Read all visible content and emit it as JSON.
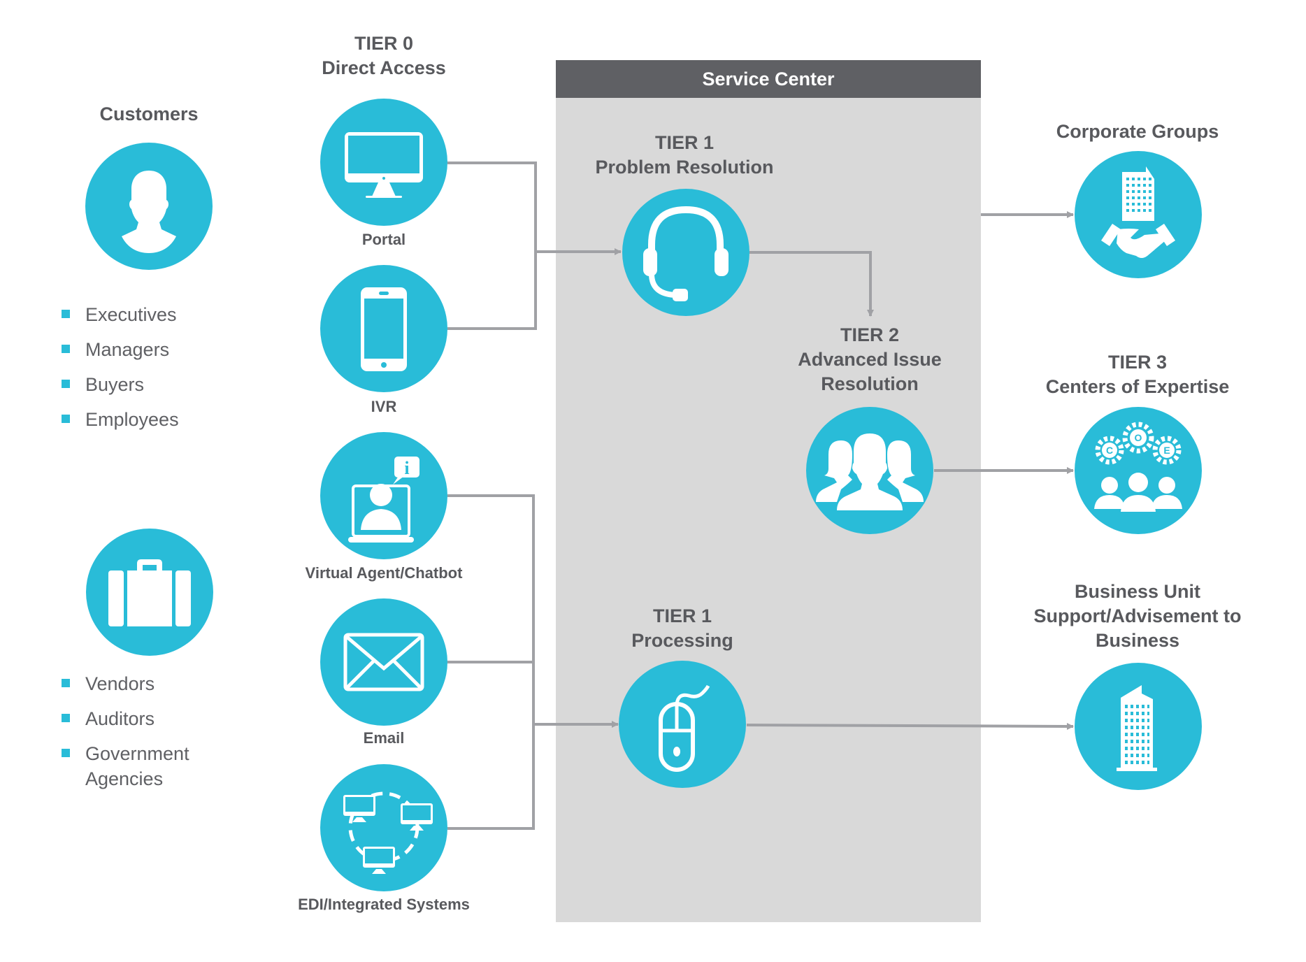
{
  "colors": {
    "accent": "#29bcd8",
    "text": "#58595d",
    "panel": "#d9d9d9",
    "panel_header": "#5f6064",
    "connector": "#a0a1a5"
  },
  "customers": {
    "title": "Customers",
    "icon": "person-icon",
    "items": [
      "Executives",
      "Managers",
      "Buyers",
      "Employees"
    ]
  },
  "partners": {
    "icon": "briefcase-icon",
    "items": [
      "Vendors",
      "Auditors",
      "Government",
      "Agencies"
    ]
  },
  "tier0": {
    "tier": "TIER 0",
    "name": "Direct Access",
    "channels": [
      {
        "label": "Portal",
        "icon": "desktop-monitor-icon"
      },
      {
        "label": "IVR",
        "icon": "smartphone-icon"
      },
      {
        "label": "Virtual Agent/Chatbot",
        "icon": "virtual-agent-icon"
      },
      {
        "label": "Email",
        "icon": "envelope-icon"
      },
      {
        "label": "EDI/Integrated Systems",
        "icon": "networked-computers-icon"
      }
    ]
  },
  "service_center": {
    "title": "Service Center",
    "tier1_problem": {
      "tier": "TIER 1",
      "name": "Problem Resolution",
      "icon": "headset-icon"
    },
    "tier2": {
      "tier": "TIER 2",
      "line1": "Advanced Issue",
      "line2": "Resolution",
      "icon": "team-icon"
    },
    "tier1_processing": {
      "tier": "TIER 1",
      "name": "Processing",
      "icon": "computer-mouse-icon"
    }
  },
  "outcomes": {
    "corporate": {
      "name": "Corporate Groups",
      "icon": "building-handshake-icon"
    },
    "tier3": {
      "tier": "TIER 3",
      "name": "Centers of Expertise",
      "icon": "coe-gears-people-icon"
    },
    "business_unit": {
      "line1": "Business Unit",
      "line2": "Support/Advisement to",
      "line3": "Business",
      "icon": "office-building-icon"
    }
  }
}
